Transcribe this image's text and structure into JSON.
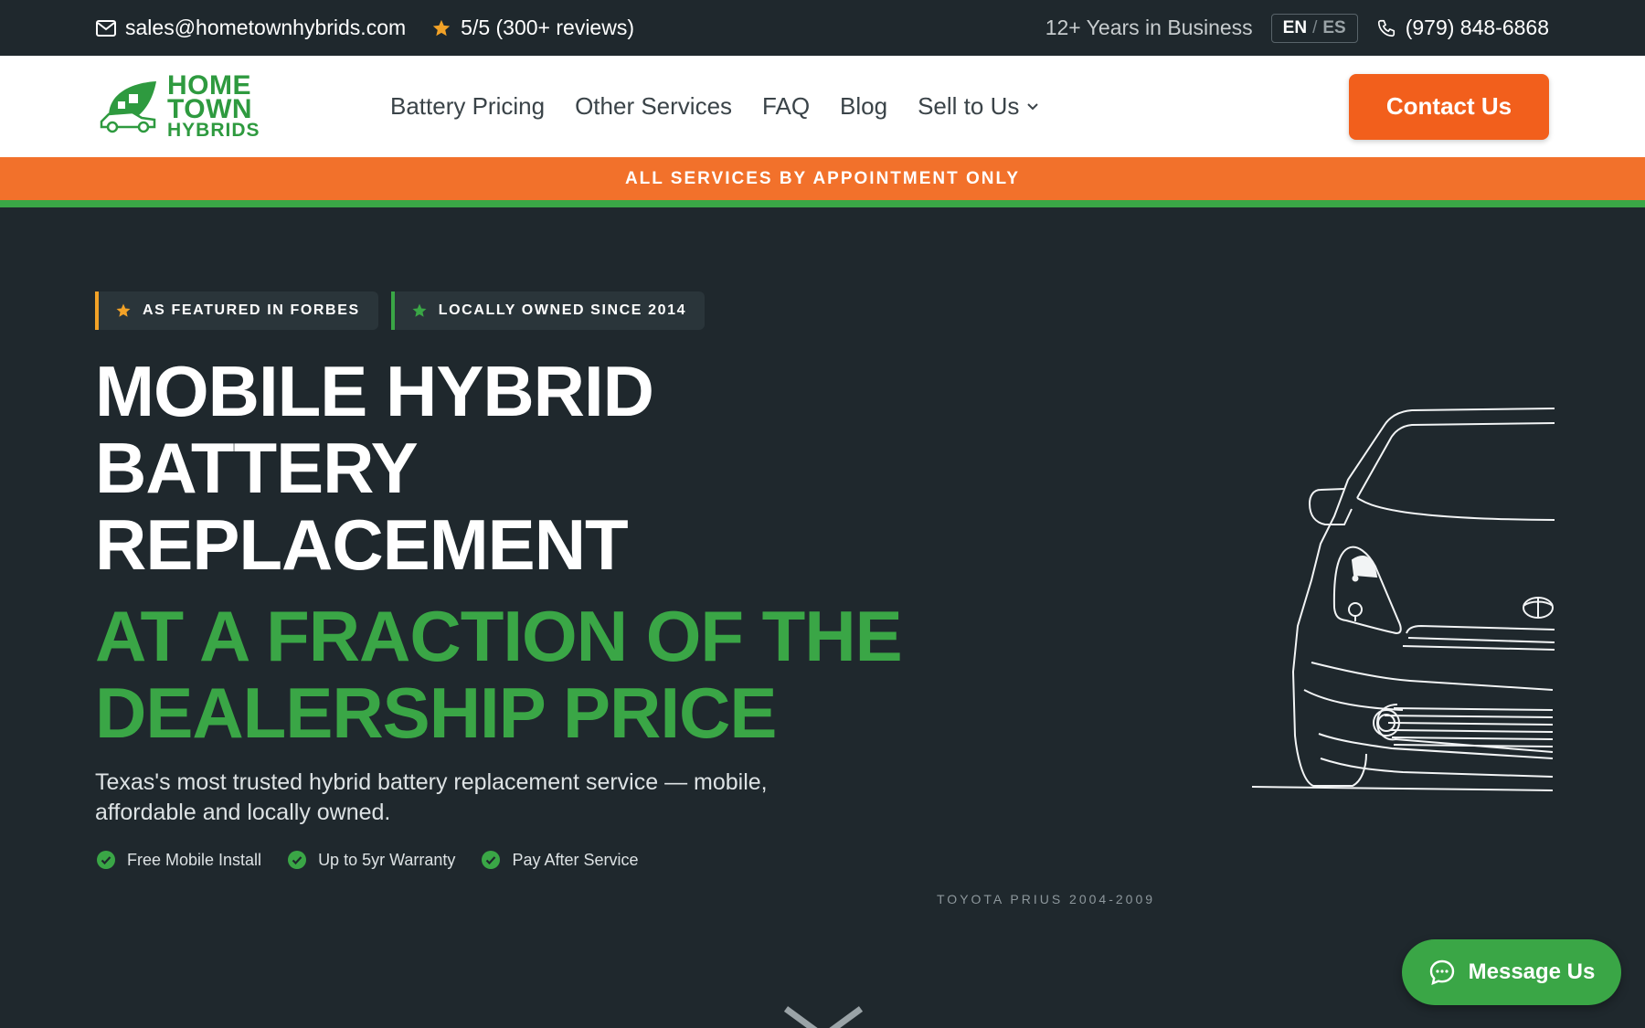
{
  "topbar": {
    "email": "sales@hometownhybrids.com",
    "rating": "5/5 (300+ reviews)",
    "years": "12+ Years in Business",
    "lang_en": "EN",
    "lang_sep": "/",
    "lang_es": "ES",
    "phone": "(979) 848-6868"
  },
  "logo": {
    "line1": "HOME",
    "line2": "TOWN",
    "line3": "HYBRIDS"
  },
  "nav": {
    "items": [
      "Battery Pricing",
      "Other Services",
      "FAQ",
      "Blog",
      "Sell to Us"
    ],
    "contact": "Contact Us"
  },
  "banner": "ALL SERVICES BY APPOINTMENT ONLY",
  "hero": {
    "badges": [
      "AS FEATURED IN FORBES",
      "LOCALLY OWNED SINCE 2014"
    ],
    "title_lines": [
      "MOBILE HYBRID",
      "BATTERY",
      "REPLACEMENT"
    ],
    "accent_lines": [
      "AT A FRACTION OF THE",
      "DEALERSHIP PRICE"
    ],
    "subtitle": "Texas's most trusted hybrid battery replacement service — mobile, affordable and locally owned.",
    "checks": [
      "Free Mobile Install",
      "Up to 5yr Warranty",
      "Pay After Service"
    ],
    "car_caption": "TOYOTA PRIUS 2004-2009"
  },
  "message_button": "Message Us",
  "colors": {
    "dark": "#1f282d",
    "orange": "#f25f1c",
    "green": "#3aa646",
    "gold": "#f2a227"
  }
}
